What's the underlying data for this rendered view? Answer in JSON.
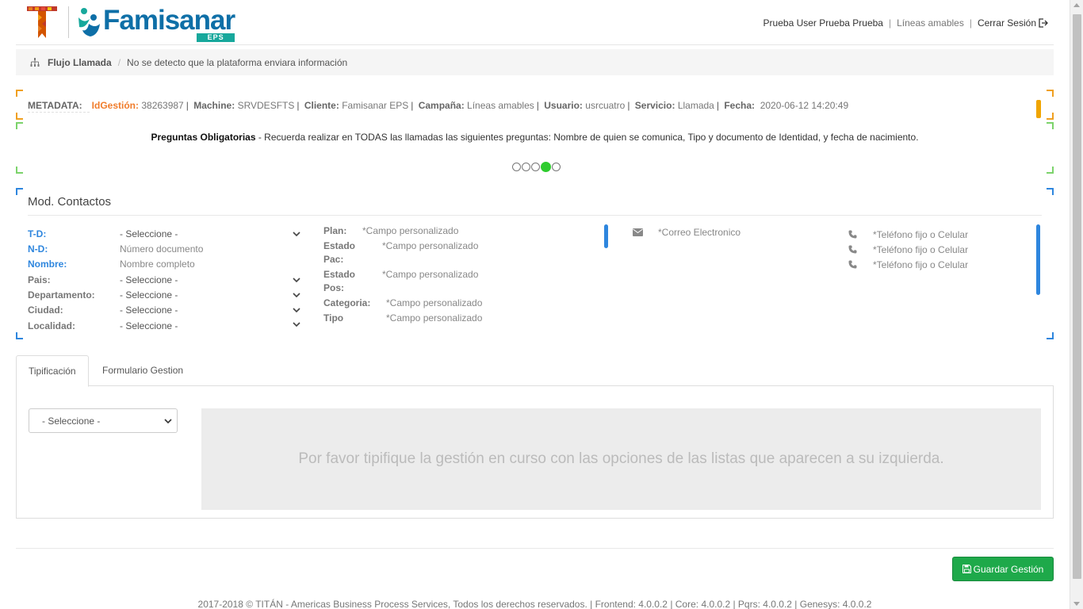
{
  "header": {
    "user_name": "Prueba User Prueba Prueba",
    "campaign": "Líneas amables",
    "logout_label": "Cerrar Sesión",
    "brand_name": "Famisanar",
    "brand_sub": "EPS"
  },
  "breadcrumb": {
    "main": "Flujo Llamada",
    "separator": "/",
    "message": "No se detecto que la plataforma enviara información"
  },
  "metadata": {
    "title": "METADATA:",
    "id_label": "IdGestión:",
    "id_value": "38263987",
    "machine_label": "Machine:",
    "machine_value": "SRVDESFTS",
    "cliente_label": "Cliente:",
    "cliente_value": "Famisanar EPS",
    "campana_label": "Campaña:",
    "campana_value": "Líneas amables",
    "usuario_label": "Usuario:",
    "usuario_value": "usrcuatro",
    "servicio_label": "Servicio:",
    "servicio_value": "Llamada",
    "fecha_label": "Fecha:",
    "fecha_value": "2020-06-12 14:20:49"
  },
  "preguntas": {
    "title": "Preguntas Obligatorias",
    "text": " - Recuerda realizar en TODAS las llamadas las siguientes preguntas: Nombre de quien se comunica, Tipo y documento de Identidad, y fecha de nacimiento.",
    "carousel_dots": 5,
    "active_dot": 4
  },
  "contacts": {
    "title": "Mod. Contactos",
    "fields": [
      {
        "label": "T-D:",
        "value": "- Seleccione -"
      },
      {
        "label": "N-D:",
        "value": "Número documento"
      },
      {
        "label": "Nombre:",
        "value": "Nombre completo"
      },
      {
        "label": "Pais:",
        "value": "- Seleccione -"
      },
      {
        "label": "Departamento:",
        "value": "- Seleccione -"
      },
      {
        "label": "Ciudad:",
        "value": "- Seleccione -"
      },
      {
        "label": "Localidad:",
        "value": "- Seleccione -"
      }
    ],
    "custom": {
      "plan_label": "Plan:",
      "plan_value": "*Campo personalizado",
      "estado_pac_label1": "Estado",
      "estado_pac_label2": "Pac:",
      "estado_pac_value": "*Campo personalizado",
      "estado_pos_label1": "Estado",
      "estado_pos_label2": "Pos:",
      "estado_pos_value": "*Campo personalizado",
      "categoria_label": "Categoria:",
      "categoria_value": "*Campo personalizado",
      "tipo_label": "Tipo",
      "tipo_value": "*Campo personalizado"
    },
    "email": "*Correo Electronico",
    "phones": [
      "*Teléfono fijo o Celular",
      "*Teléfono fijo o Celular",
      "*Teléfono fijo o Celular"
    ]
  },
  "tabs": {
    "tipificacion": "Tipificación",
    "formulario": "Formulario Gestion"
  },
  "tipificacion": {
    "select_value": "- Seleccione -",
    "info_text": "Por favor tipifique la gestión en curso con las opciones de las listas que aparecen a su izquierda."
  },
  "footer": {
    "save_label": "Guardar Gestión",
    "copyright": "2017-2018 © TITÁN - Americas Business Process Services, Todos los derechos reservados. | Frontend: 4.0.0.2 | Core: 4.0.0.2 | Pqrs: 4.0.0.2 | Genesys: 4.0.0.2"
  },
  "colors": {
    "brand_blue": "#0e6fa7",
    "accent_orange": "#f07c2b",
    "link_blue": "#2e86de",
    "success_green": "#1ea94a",
    "carousel_active": "#2ecc2e"
  }
}
